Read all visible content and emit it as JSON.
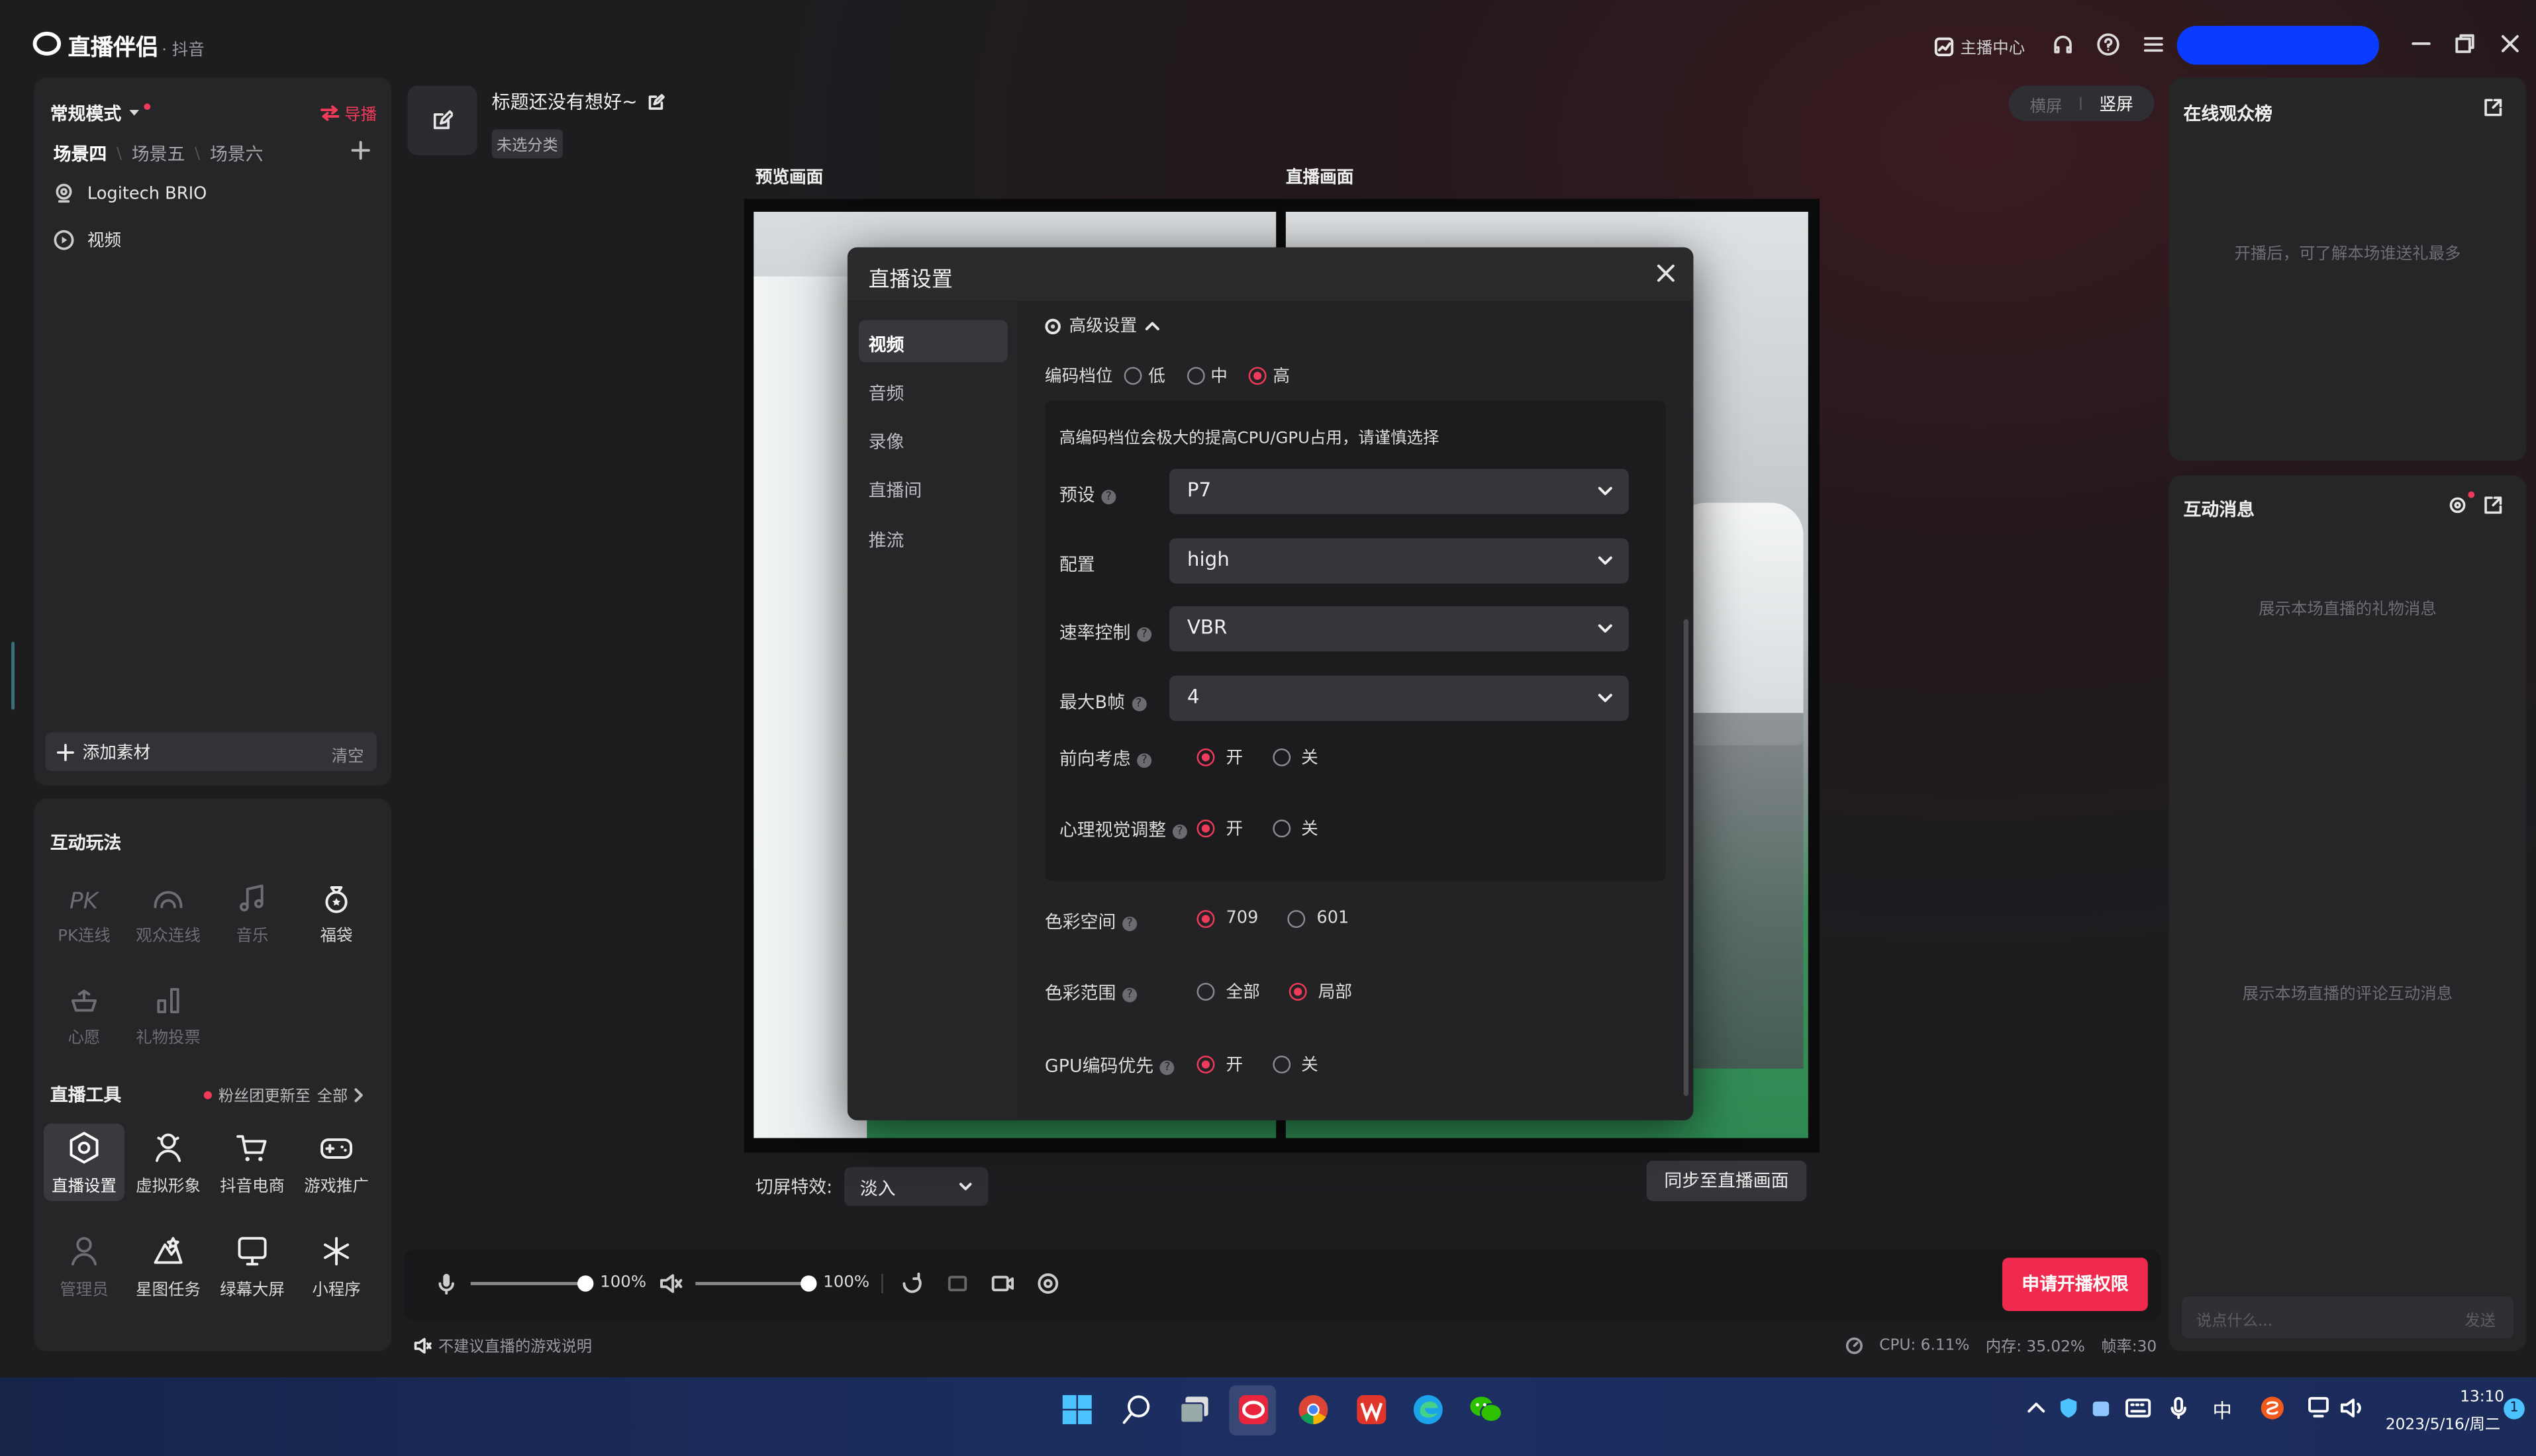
{
  "app": {
    "title": "直播伴侣",
    "subtitle": "· 抖音"
  },
  "titlebar": {
    "anchor_center": "主播中心",
    "user_badge": ""
  },
  "left": {
    "mode": "常规模式",
    "switch_btn": "导播",
    "scenes": [
      "场景四",
      "场景五",
      "场景六"
    ],
    "sources": [
      {
        "label": "Logitech BRIO",
        "icon": "camera-icon"
      },
      {
        "label": "视频",
        "icon": "play-icon"
      }
    ],
    "add_material": "添加素材",
    "clear": "清空",
    "interact_title": "互动玩法",
    "interact_items": [
      {
        "label": "PK连线",
        "enabled": false
      },
      {
        "label": "观众连线",
        "enabled": false
      },
      {
        "label": "音乐",
        "enabled": false
      },
      {
        "label": "福袋",
        "enabled": true
      },
      {
        "label": "心愿",
        "enabled": false
      },
      {
        "label": "礼物投票",
        "enabled": false
      }
    ],
    "tools_title": "直播工具",
    "fan_update": "粉丝团更新至",
    "all": "全部",
    "tools": [
      {
        "label": "直播设置",
        "enabled": true
      },
      {
        "label": "虚拟形象",
        "enabled": true
      },
      {
        "label": "抖音电商",
        "enabled": true
      },
      {
        "label": "游戏推广",
        "enabled": true
      },
      {
        "label": "管理员",
        "enabled": false
      },
      {
        "label": "星图任务",
        "enabled": true
      },
      {
        "label": "绿幕大屏",
        "enabled": true
      },
      {
        "label": "小程序",
        "enabled": true
      }
    ]
  },
  "stream": {
    "title": "标题还没有想好~",
    "category": "未选分类"
  },
  "orientation": {
    "landscape": "横屏",
    "portrait": "竖屏"
  },
  "preview": {
    "preview_label": "预览画面",
    "live_label": "直播画面",
    "transition_label": "切屏特效:",
    "transition_value": "淡入",
    "sync_btn": "同步至直播画面"
  },
  "dialog": {
    "title": "直播设置",
    "nav": [
      "视频",
      "音频",
      "录像",
      "直播间",
      "推流"
    ],
    "advanced": "高级设置",
    "encode_level_label": "编码档位",
    "encode_levels": [
      "低",
      "中",
      "高"
    ],
    "encode_selected": 2,
    "warning": "高编码档位会极大的提高CPU/GPU占用，请谨慎选择",
    "preset_label": "预设",
    "preset_value": "P7",
    "profile_label": "配置",
    "profile_value": "high",
    "rate_label": "速率控制",
    "rate_value": "VBR",
    "bframe_label": "最大B帧",
    "bframe_value": "4",
    "lookahead_label": "前向考虑",
    "psycho_label": "心理视觉调整",
    "on": "开",
    "off": "关",
    "colorspace_label": "色彩空间",
    "cs_709": "709",
    "cs_601": "601",
    "colorrange_label": "色彩范围",
    "range_full": "全部",
    "range_partial": "局部",
    "gpu_label": "GPU编码优先"
  },
  "bottom": {
    "mic_volume": "100%",
    "speaker_volume": "100%",
    "apply_btn": "申请开播权限",
    "notice": "不建议直播的游戏说明",
    "cpu": "CPU: 6.11%",
    "memory": "内存: 35.02%",
    "fps": "帧率:30"
  },
  "right": {
    "audience_title": "在线观众榜",
    "audience_empty": "开播后，可了解本场谁送礼最多",
    "msg_title": "互动消息",
    "gift_empty": "展示本场直播的礼物消息",
    "comment_empty": "展示本场直播的评论互动消息",
    "input_placeholder": "说点什么...",
    "send": "发送"
  },
  "taskbar": {
    "ime": "中",
    "time": "13:10",
    "date": "2023/5/16/周二",
    "notify_count": "1"
  },
  "colors": {
    "accent": "#f03a5a",
    "user_badge": "#0a3cff"
  }
}
